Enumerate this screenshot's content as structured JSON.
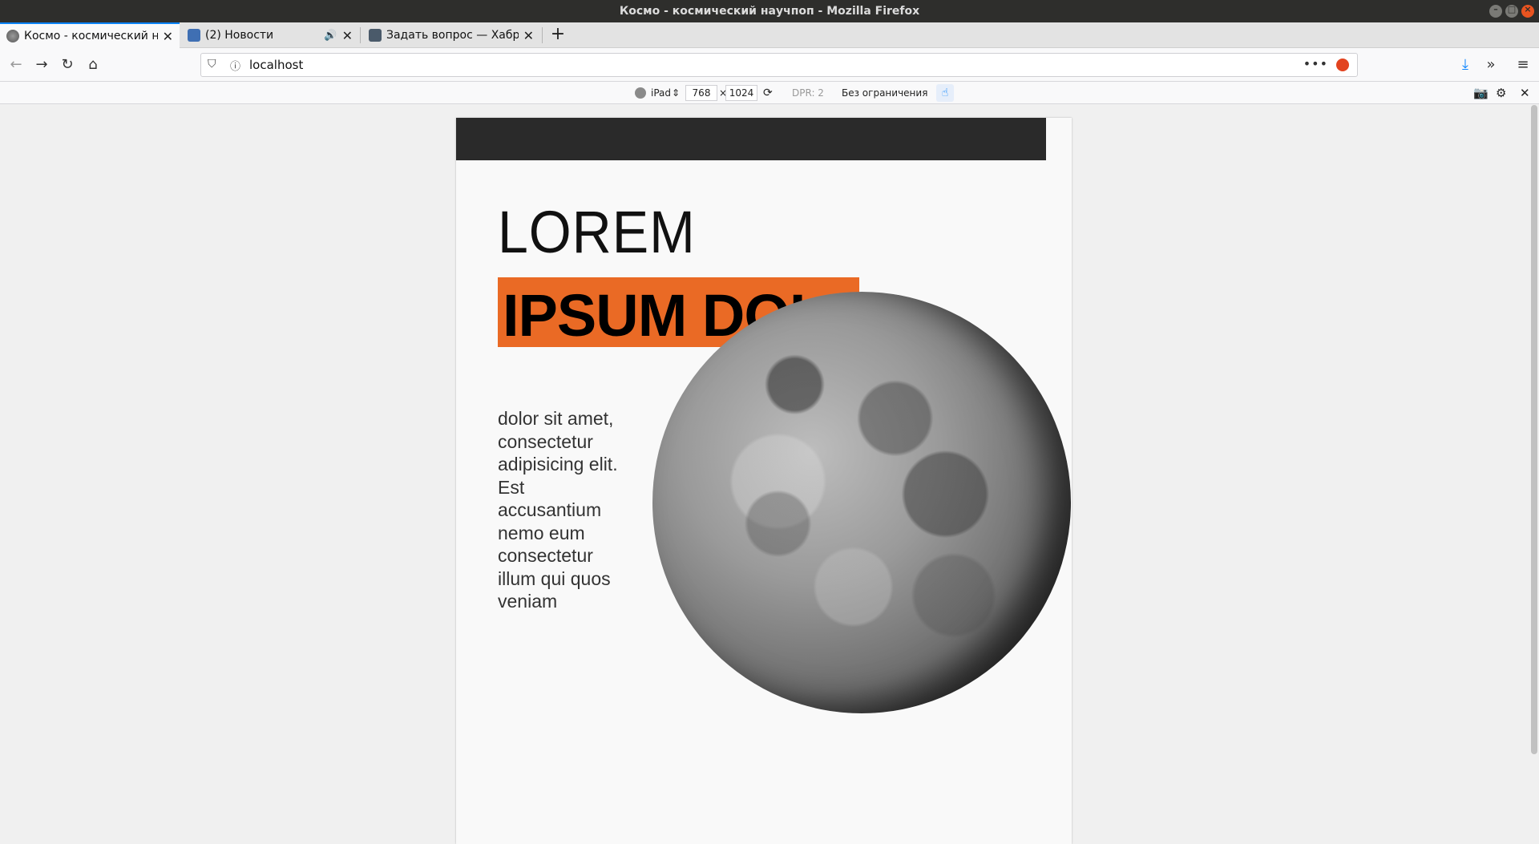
{
  "window": {
    "title": "Космо - космический научпоп - Mozilla Firefox"
  },
  "tabs": [
    {
      "label": "Космо - космический на",
      "active": true,
      "favicon": "globe-icon"
    },
    {
      "label": "(2) Новости",
      "active": false,
      "favicon": "play-icon",
      "audio": true
    },
    {
      "label": "Задать вопрос — Хабр Q",
      "active": false,
      "favicon": "habr-icon"
    }
  ],
  "navbar": {
    "url": "localhost"
  },
  "rdm": {
    "device": "iPad",
    "width": "768",
    "times": "×",
    "height": "1024",
    "dpr": "DPR: 2",
    "throttle": "Без ограничения"
  },
  "page": {
    "headline_light": "LOREM",
    "headline_bold": "IPSUM DOLOR",
    "body": "dolor sit amet, consectetur adipisicing elit. Est accusantium nemo eum consectetur illum qui quos veniam"
  },
  "colors": {
    "accent_orange": "#ea6a25",
    "header_dark": "#2a2a2a",
    "tab_highlight": "#0a84ff"
  }
}
